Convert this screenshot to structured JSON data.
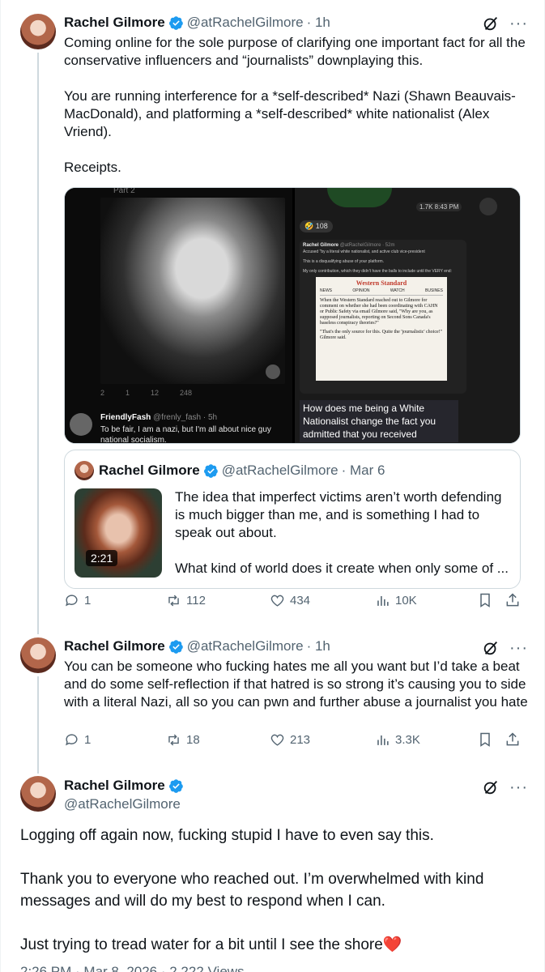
{
  "tweets": [
    {
      "name": "Rachel Gilmore",
      "handle": "@atRachelGilmore",
      "time": "· 1h",
      "text": "Coming online for the sole purpose of clarifying one important fact for all the conservative influencers and “journalists” downplaying this.\n\nYou are running interference for a *self-described* Nazi (Shawn Beauvais-MacDonald), and platforming a *self-described* white nationalist (Alex Vriend).\n\nReceipts.",
      "stats": {
        "replies": "1",
        "reposts": "112",
        "likes": "434",
        "views": "10K"
      }
    },
    {
      "name": "Rachel Gilmore",
      "handle": "@atRachelGilmore",
      "time": "· 1h",
      "text": "You can be someone who fucking hates me all you want but I’d take a beat and do some self-reflection if that hatred is so strong it’s causing you to side with a literal Nazi, all so you can pwn and further abuse a journalist you hate",
      "stats": {
        "replies": "1",
        "reposts": "18",
        "likes": "213",
        "views": "3.3K"
      }
    },
    {
      "name": "Rachel Gilmore",
      "handle": "@atRachelGilmore",
      "text": "Logging off again now, fucking stupid I have to even say this.\n\nThank you to everyone who reached out. I’m overwhelmed with kind messages and will do my best to respond when I can.\n\nJust trying to tread water for a bit until I see the shore❤️"
    }
  ],
  "media": {
    "left": {
      "top_label": "Part 2",
      "stats": {
        "replies": "2",
        "reposts": "1",
        "likes": "12",
        "views": "248"
      },
      "reply_name": "FriendlyFash",
      "reply_handle": "@frenly_fash · 5h",
      "reply_text": "To be fair, I am a nazi, but I'm all about nice guy national socialism."
    },
    "right": {
      "views_badge": "1.7K 8:43 PM",
      "reaction_count": "108",
      "inner_name": "Rachel Gilmore",
      "inner_handle": "@atRachelGilmore · 52m",
      "inner_line1": "Accused \"by a literal white nationalist, and active club vice-president",
      "inner_line2": "This is a disqualifying abuse of your platform.",
      "inner_line3": "My only contribution, which they didn't have the balls to include until the VERY end:",
      "paper_name": "Western Standard",
      "paper_tabs": [
        "NEWS",
        "OPINION",
        "WATCH",
        "BUSINES"
      ],
      "article_p1": "When the Western Standard reached out to Gilmore for comment on whether she had been coordinating with CAHN or Public Safety via email Gilmore said, \"Why are you, as supposed journalists, reporting on Second Sons Canada's baseless conspiracy theories?\"",
      "article_p2": "\"That's the only source for this. Quite the 'journalistic' choice!\" Gilmore said.",
      "caption": "How does me being a White Nationalist change the fact you admitted that you received"
    }
  },
  "quote": {
    "name": "Rachel Gilmore",
    "handle": "@atRachelGilmore",
    "date": "· Mar 6",
    "duration": "2:21",
    "text": "The idea that imperfect victims aren’t worth defending is much bigger than me, and is something I had to speak out about.\n\nWhat kind of world does it create when only some of ..."
  },
  "footer": {
    "text": "2:26 PM · Mar 8, 2026 · 2,222 Views"
  },
  "colors": {
    "accent": "#1d9bf0",
    "muted": "#536471",
    "heart": "#e0245e"
  },
  "icons": [
    "verified-icon",
    "grok-icon",
    "more-icon",
    "reply-icon",
    "repost-icon",
    "like-icon",
    "views-icon",
    "bookmark-icon",
    "share-icon",
    "heart-emoji"
  ]
}
